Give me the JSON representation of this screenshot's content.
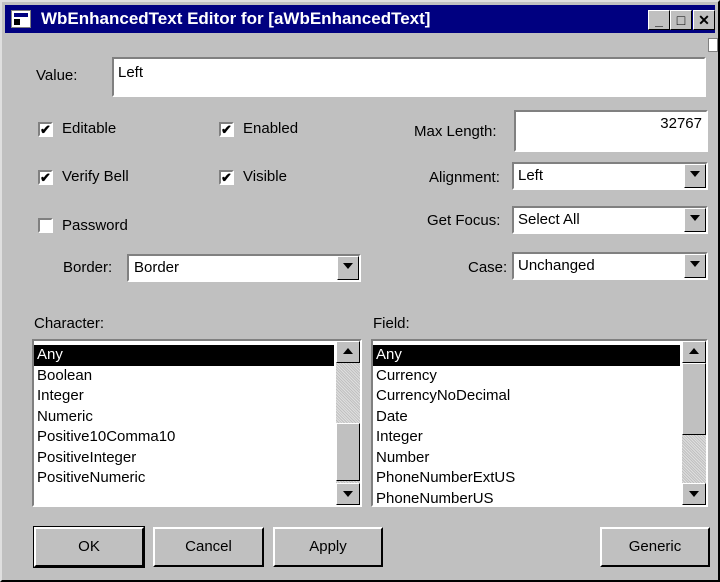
{
  "window": {
    "title": "WbEnhancedText Editor for [aWbEnhancedText]",
    "minimize_glyph": "_",
    "maximize_glyph": "□",
    "close_glyph": "✕",
    "title_bar_color": "#000080"
  },
  "value": {
    "label": "Value:",
    "text": "Left"
  },
  "checkboxes": {
    "editable": {
      "label": "Editable",
      "checked": true
    },
    "enabled": {
      "label": "Enabled",
      "checked": true
    },
    "verify_bell": {
      "label": "Verify Bell",
      "checked": true
    },
    "visible": {
      "label": "Visible",
      "checked": true
    },
    "password": {
      "label": "Password",
      "checked": false
    }
  },
  "check_glyph": "✔",
  "border": {
    "label": "Border:",
    "value": "Border"
  },
  "max_length": {
    "label": "Max Length:",
    "value": "32767"
  },
  "alignment": {
    "label": "Alignment:",
    "value": "Left"
  },
  "get_focus": {
    "label": "Get Focus:",
    "value": "Select All"
  },
  "case": {
    "label": "Case:",
    "value": "Unchanged"
  },
  "character": {
    "label": "Character:",
    "items": [
      "Any",
      "Boolean",
      "Integer",
      "Numeric",
      "Positive10Comma10",
      "PositiveInteger",
      "PositiveNumeric"
    ],
    "selected": "Any"
  },
  "field": {
    "label": "Field:",
    "items": [
      "Any",
      "Currency",
      "CurrencyNoDecimal",
      "Date",
      "Integer",
      "Number",
      "PhoneNumberExtUS",
      "PhoneNumberUS"
    ],
    "selected": "Any"
  },
  "buttons": {
    "ok": "OK",
    "cancel": "Cancel",
    "apply": "Apply",
    "generic": "Generic"
  }
}
